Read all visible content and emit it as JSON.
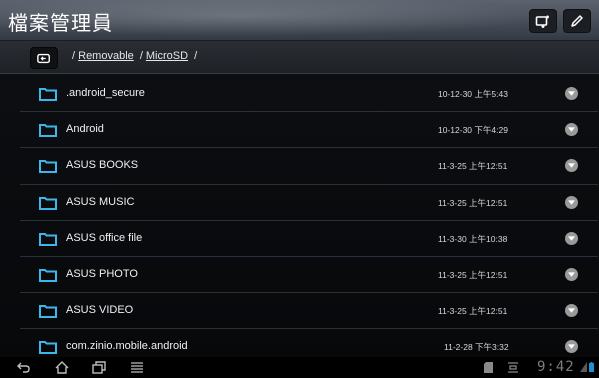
{
  "app": {
    "title": "檔案管理員"
  },
  "path": {
    "root": "/",
    "segments": [
      {
        "label": "Removable"
      },
      {
        "label": "MicroSD"
      }
    ],
    "sep": "/"
  },
  "files": [
    {
      "name": ".android_secure",
      "date": "10-12-30 上午5:43"
    },
    {
      "name": "Android",
      "date": "10-12-30 下午4:29"
    },
    {
      "name": "ASUS BOOKS",
      "date": "11-3-25 上午12:51"
    },
    {
      "name": "ASUS MUSIC",
      "date": "11-3-25 上午12:51"
    },
    {
      "name": "ASUS office file",
      "date": "11-3-30 上午10:38"
    },
    {
      "name": "ASUS PHOTO",
      "date": "11-3-25 上午12:51"
    },
    {
      "name": "ASUS VIDEO",
      "date": "11-3-25 上午12:51"
    },
    {
      "name": "com.zinio.mobile.android",
      "date": "11-2-28 下午3:32"
    }
  ],
  "status": {
    "time": "9:42"
  },
  "colors": {
    "folder": "#3fb6ea",
    "accent": "#ffffff",
    "more": "#9a9a9a"
  },
  "icons": {
    "toolbar": [
      "new-folder-icon",
      "edit-icon"
    ],
    "path": "back-folder-icon",
    "nav": [
      "back-icon",
      "home-icon",
      "recent-apps-icon",
      "menu-icon"
    ]
  }
}
